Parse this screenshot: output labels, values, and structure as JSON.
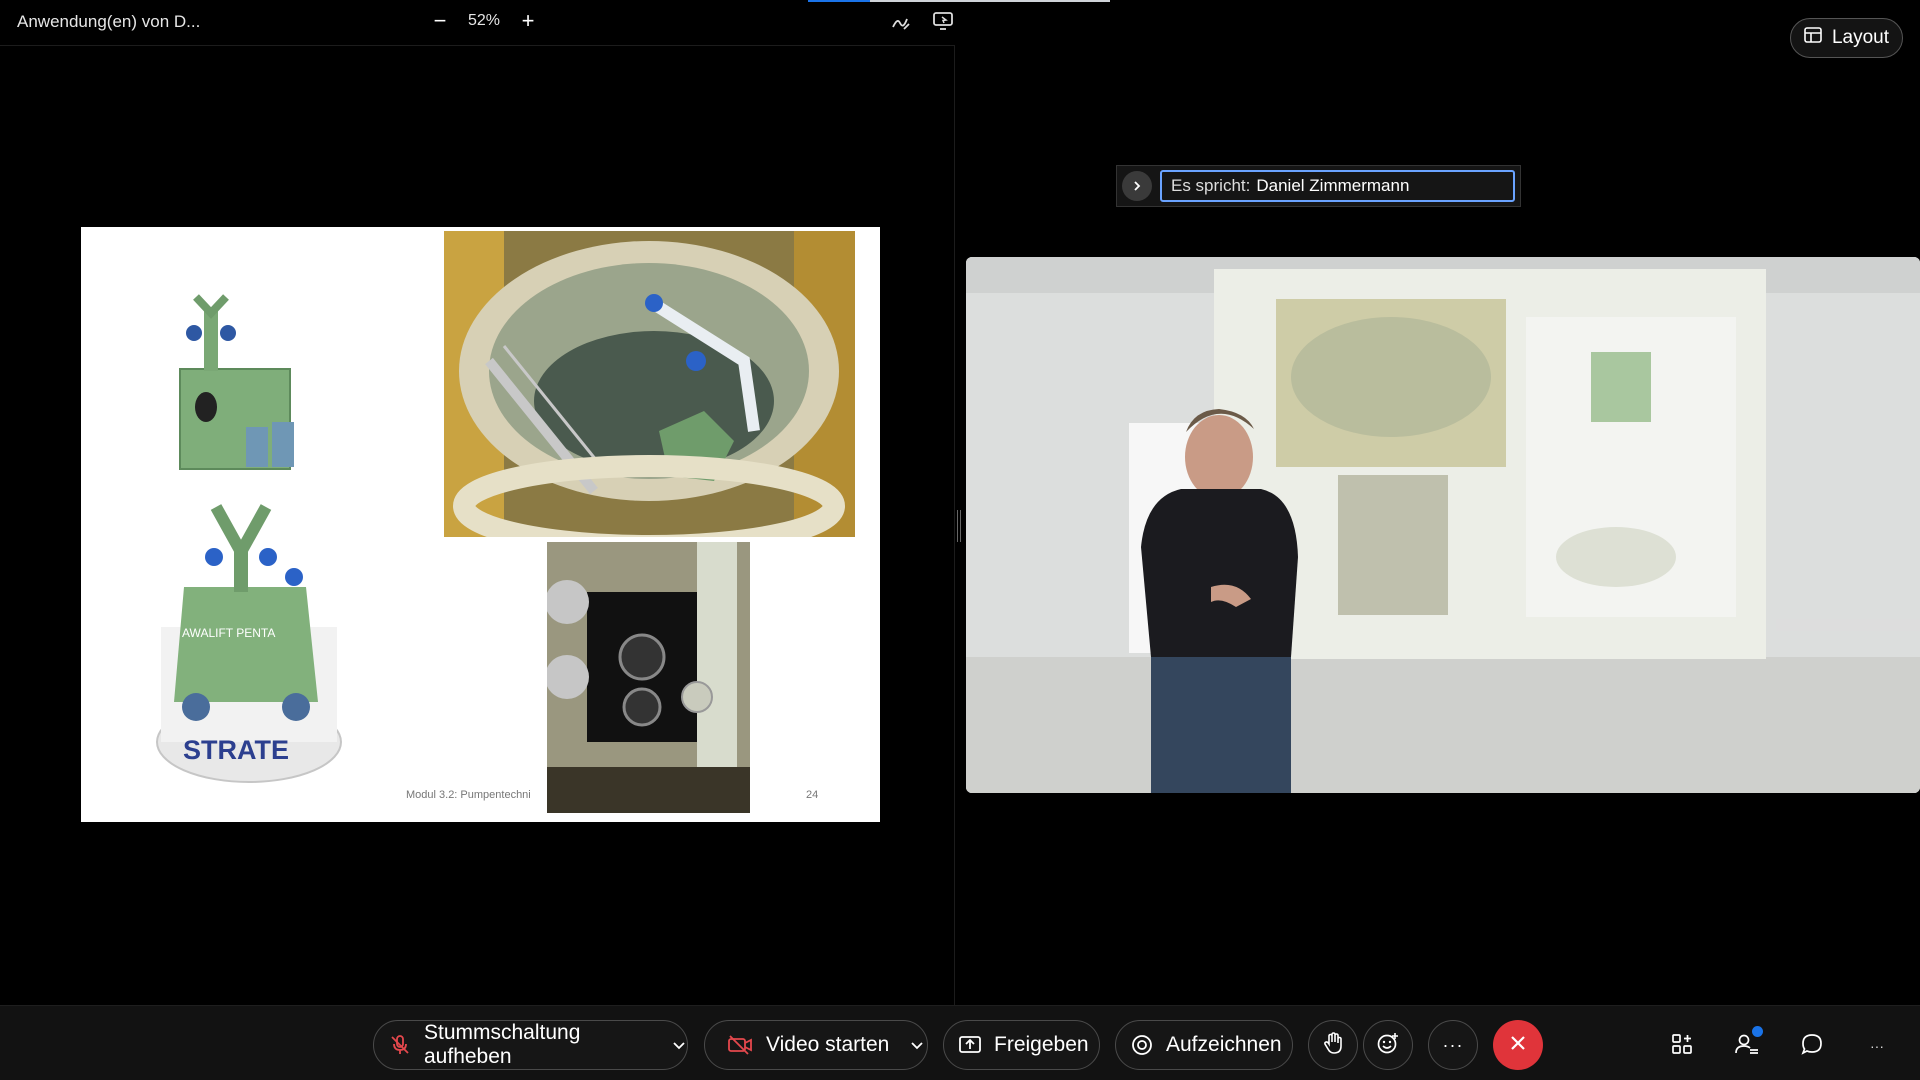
{
  "share": {
    "title": "Anwendung(en) von D...",
    "zoom": "52%",
    "zoom_out_label": "−",
    "zoom_in_label": "+"
  },
  "slide": {
    "footer": "Modul 3.2: Pumpentechni",
    "page_number": "24",
    "brand_text": "STRATE",
    "product_text": "AWALIFT PENTA"
  },
  "layout_button": {
    "label": "Layout"
  },
  "speaker": {
    "prefix": "Es spricht:",
    "name": "Daniel Zimmermann"
  },
  "toolbar": {
    "mute_label": "Stummschaltung aufheben",
    "video_label": "Video starten",
    "share_label": "Freigeben",
    "record_label": "Aufzeichnen",
    "more_label": "···",
    "overflow_label": "···"
  },
  "colors": {
    "accent_blue": "#1a73e8",
    "end_red": "#e0343a",
    "mute_red": "#e5484d"
  }
}
